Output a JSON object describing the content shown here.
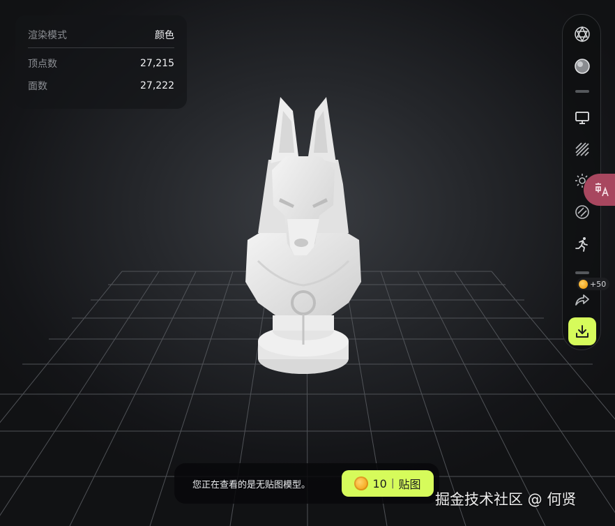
{
  "info_panel": {
    "render_mode_label": "渲染模式",
    "render_mode_value": "颜色",
    "vertices_label": "顶点数",
    "vertices_value": "27,215",
    "faces_label": "面数",
    "faces_value": "27,222"
  },
  "toolbar": {
    "tools": [
      "wireframe-sphere-icon",
      "material-sphere-icon",
      "monitor-icon",
      "stripes-icon",
      "light-icon",
      "texture-icon",
      "animation-runner-icon",
      "share-icon",
      "download-icon"
    ],
    "points_badge": "+50"
  },
  "banner": {
    "message": "您正在查看的是无贴图模型。",
    "coin_count": "10",
    "sep": "|",
    "action_label": "贴图"
  },
  "watermark": "掘金技术社区 @ 何贤",
  "colors": {
    "accent": "#d6fb5b",
    "translate_tab": "#a8475f"
  }
}
